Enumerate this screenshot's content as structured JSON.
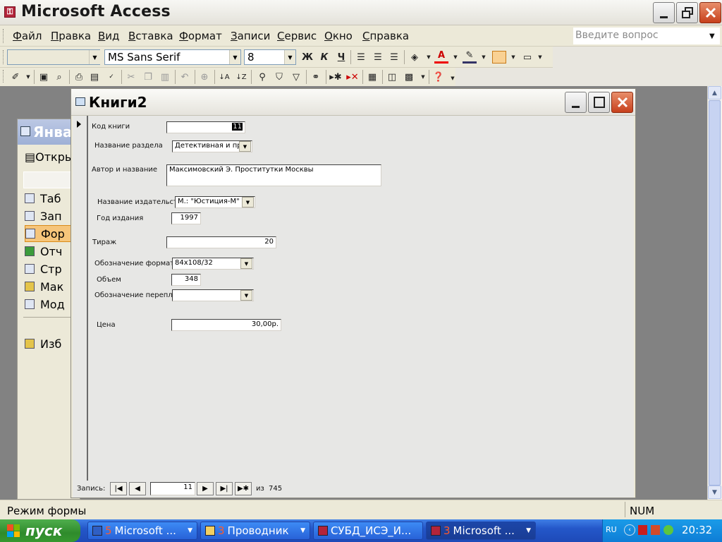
{
  "app": {
    "title": "Microsoft Access",
    "menu": [
      "Файл",
      "Правка",
      "Вид",
      "Вставка",
      "Формат",
      "Записи",
      "Сервис",
      "Окно",
      "Справка"
    ],
    "ask_placeholder": "Введите вопрос"
  },
  "format_toolbar": {
    "font_name": "MS Sans Serif",
    "font_size": "8",
    "bold": "Ж",
    "italic": "К",
    "underline": "Ч"
  },
  "db_window": {
    "title": "Янва",
    "open_label": "Откры",
    "objects": [
      "Таб",
      "Зап",
      "Фор",
      "Отч",
      "Стр",
      "Мак",
      "Мод"
    ],
    "favorites": "Изб"
  },
  "form": {
    "title": "Книги2",
    "fields": {
      "book_code": {
        "label": "Код книги",
        "value": "11"
      },
      "section": {
        "label": "Название раздела",
        "value": "Детективная и пр"
      },
      "author_title": {
        "label": "Автор и название",
        "value": "Максимовский Э. Проститутки Москвы"
      },
      "publisher": {
        "label": "Название издательст",
        "value": "М.: \"Юстиция-М\""
      },
      "year": {
        "label": "Год издания",
        "value": "1997"
      },
      "circulation": {
        "label": "Тираж",
        "value": "20"
      },
      "format": {
        "label": "Обозначение формат",
        "value": "84х108/32"
      },
      "volume": {
        "label": "Объем",
        "value": "348"
      },
      "binding": {
        "label": "Обозначение перепле",
        "value": ""
      },
      "price": {
        "label": "Цена",
        "value": "30,00р."
      }
    },
    "navigation": {
      "record_label": "Запись:",
      "current": "11",
      "of_label": "из",
      "total": "745"
    }
  },
  "status": {
    "mode": "Режим формы",
    "num": "NUM"
  },
  "taskbar": {
    "start": "пуск",
    "tasks": [
      {
        "count": "5",
        "label": "Microsoft ..."
      },
      {
        "count": "3",
        "label": "Проводник"
      },
      {
        "count": "",
        "label": "СУБД_ИСЭ_И..."
      },
      {
        "count": "3",
        "label": "Microsoft ..."
      }
    ],
    "lang": "RU",
    "clock": "20:32"
  },
  "colors": {
    "mdi_background": "#828282",
    "title_close": "#c7401c",
    "taskbar": "#2457c9",
    "start_button": "#2f8b2c"
  }
}
